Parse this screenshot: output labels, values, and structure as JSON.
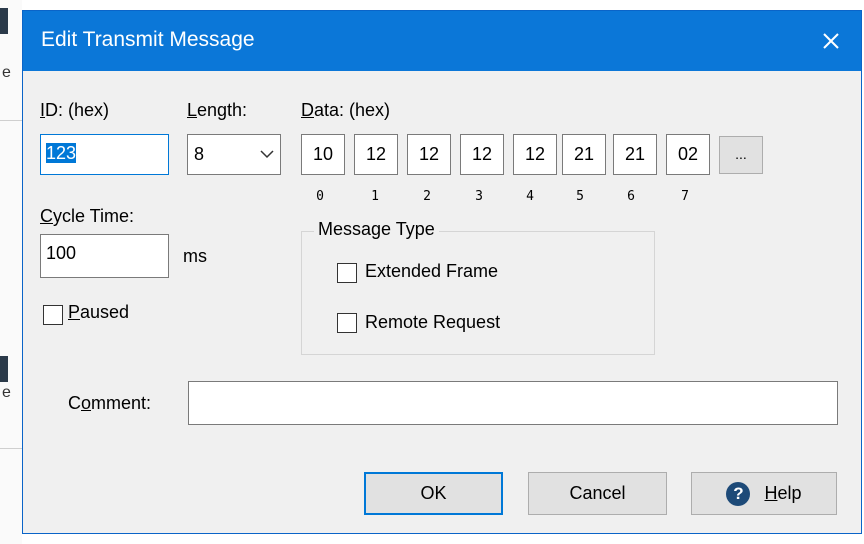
{
  "background": {
    "edge_letter_1": "e",
    "edge_letter_2": "e"
  },
  "dialog": {
    "title": "Edit Transmit Message",
    "close_icon": "close-icon"
  },
  "id_field": {
    "label_prefix": "I",
    "label_rest": "D: (hex)",
    "value": "123"
  },
  "length_field": {
    "label_prefix": "L",
    "label_rest": "ength:",
    "value": "8"
  },
  "data_field": {
    "label_prefix": "D",
    "label_rest": "ata: (hex)",
    "bytes": [
      "10",
      "12",
      "12",
      "12",
      "12",
      "21",
      "21",
      "02"
    ],
    "indices": [
      "0",
      "1",
      "2",
      "3",
      "4",
      "5",
      "6",
      "7"
    ],
    "more_button_label": "..."
  },
  "cycle_time": {
    "label_prefix": "C",
    "label_rest": "ycle Time:",
    "value": "100",
    "unit": "ms"
  },
  "paused": {
    "label_prefix": "P",
    "label_rest": "aused",
    "checked": false
  },
  "message_type": {
    "title": "Message Type",
    "extended_frame": "Extended Frame",
    "remote_request": "Remote Request"
  },
  "comment": {
    "label_pre": "C",
    "label_underlined": "o",
    "label_post": "mment:",
    "value": ""
  },
  "buttons": {
    "ok": "OK",
    "cancel": "Cancel",
    "help_prefix": "H",
    "help_rest": "elp",
    "help_icon_glyph": "?"
  },
  "colors": {
    "titlebar": "#0b77d8",
    "focus": "#0078d7",
    "dialog_bg": "#f0f0f0"
  }
}
